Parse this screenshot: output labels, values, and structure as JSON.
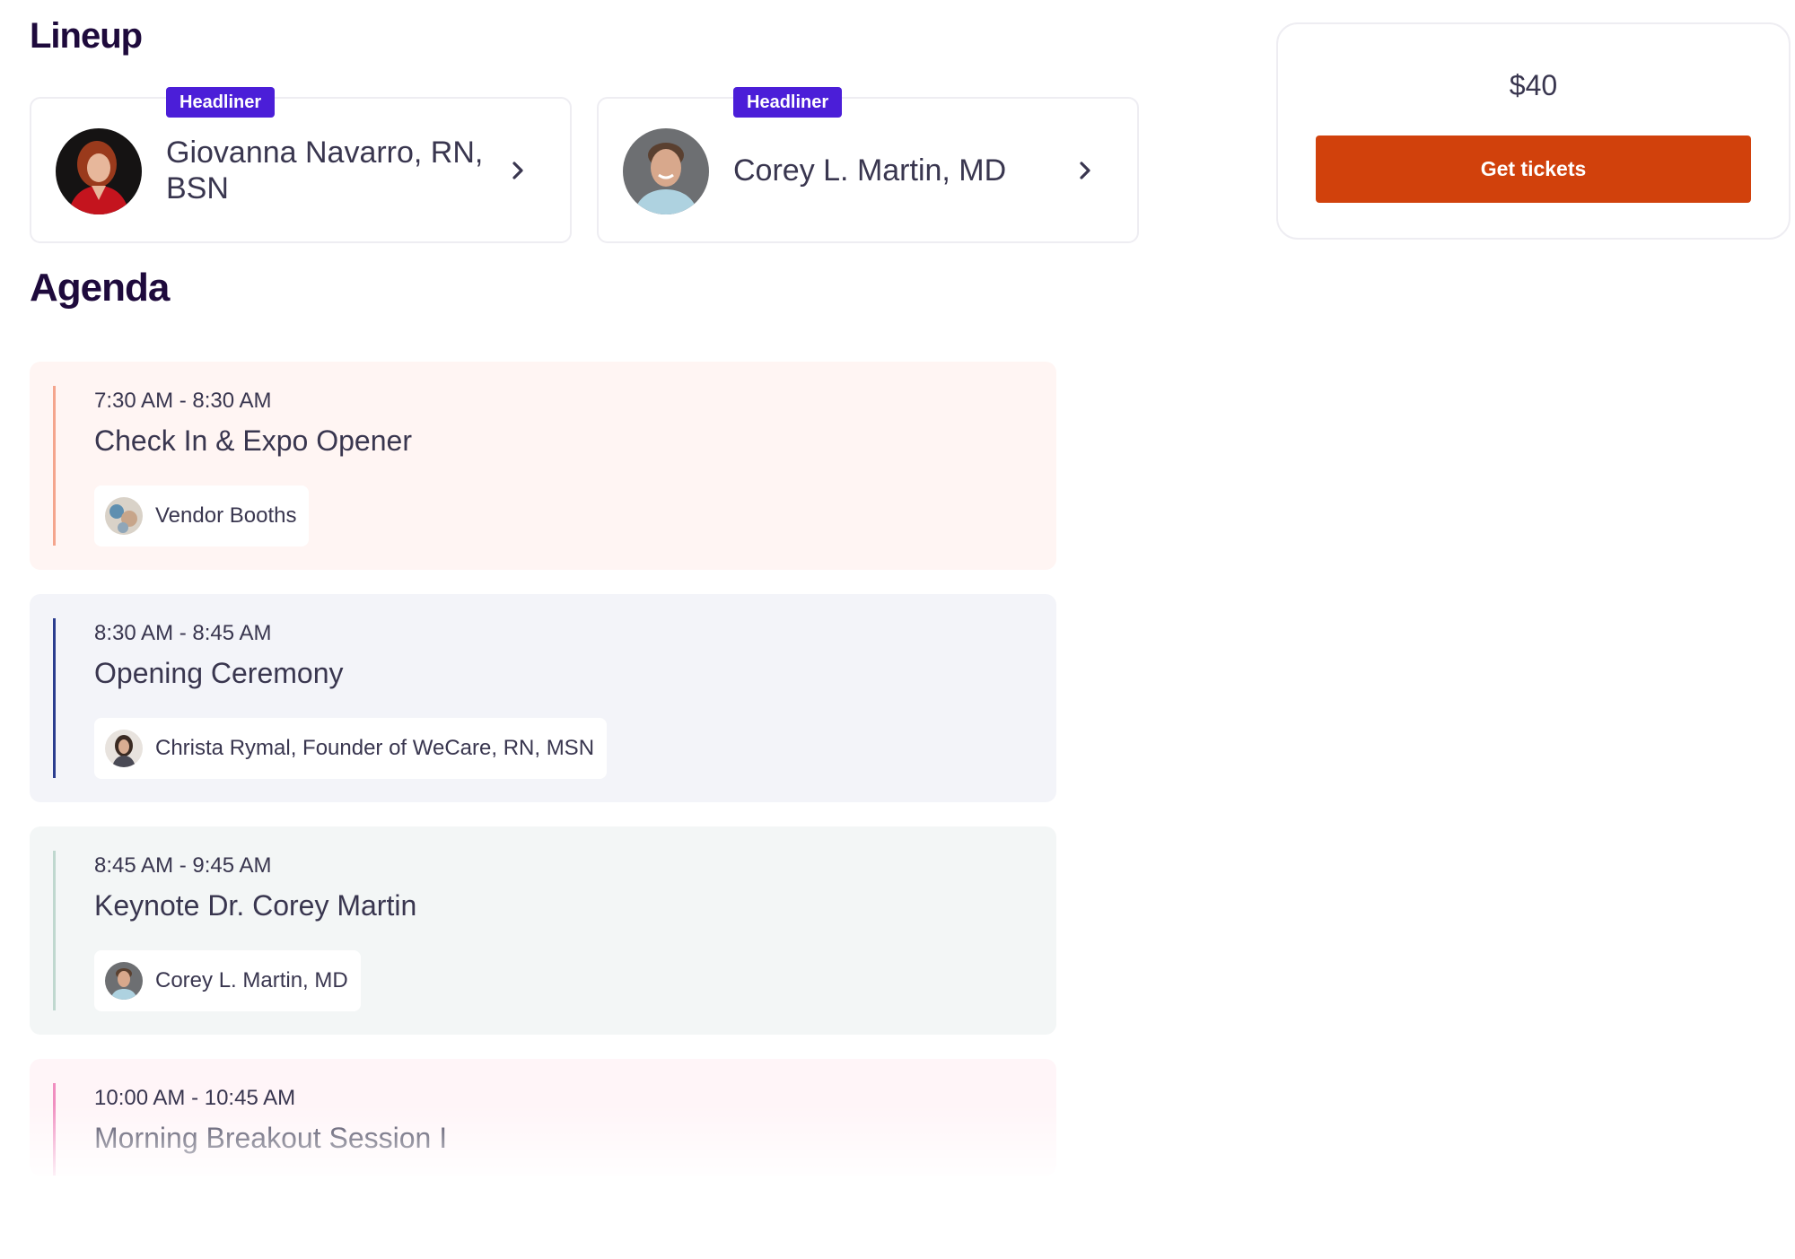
{
  "lineup": {
    "title": "Lineup",
    "speakers": [
      {
        "badge": "Headliner",
        "name": "Giovanna Navarro, RN, BSN"
      },
      {
        "badge": "Headliner",
        "name": "Corey L. Martin, MD"
      }
    ]
  },
  "ticket": {
    "price": "$40",
    "button_label": "Get tickets"
  },
  "agenda": {
    "title": "Agenda",
    "items": [
      {
        "time": "7:30 AM - 8:30 AM",
        "title": "Check In & Expo Opener",
        "host": "Vendor Booths"
      },
      {
        "time": "8:30 AM - 8:45 AM",
        "title": "Opening Ceremony",
        "host": "Christa Rymal, Founder of WeCare, RN, MSN"
      },
      {
        "time": "8:45 AM - 9:45 AM",
        "title": "Keynote Dr. Corey Martin",
        "host": "Corey L. Martin, MD"
      },
      {
        "time": "10:00 AM - 10:45 AM",
        "title": "Morning Breakout Session I"
      }
    ]
  },
  "colors": {
    "accent_purple": "#4b1ed8",
    "cta_orange": "#d1410c",
    "heading": "#1e0a3c",
    "body_text": "#39364f"
  },
  "icons": [
    "chevron-right-icon",
    "chevron-right-icon"
  ]
}
